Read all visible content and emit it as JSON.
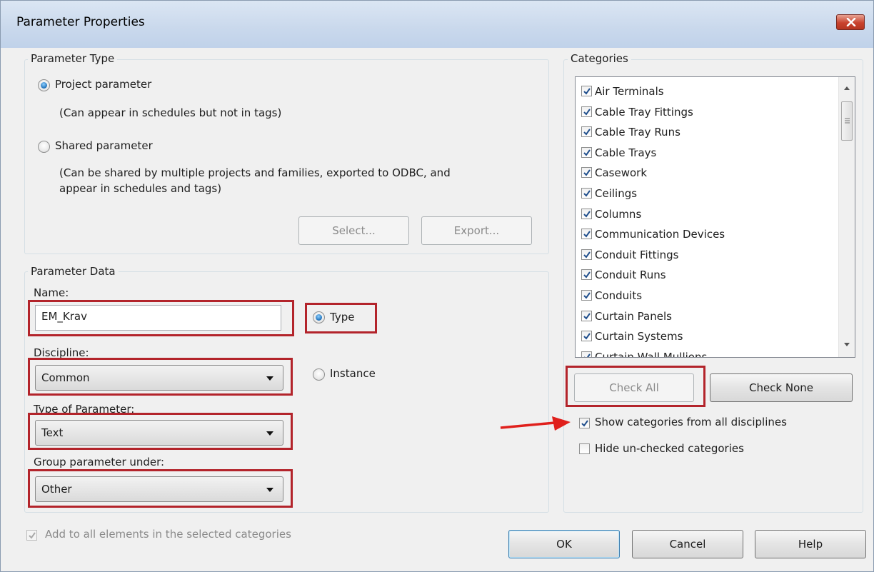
{
  "window": {
    "title": "Parameter Properties"
  },
  "parameter_type": {
    "legend": "Parameter Type",
    "project_label": "Project parameter",
    "project_desc": "(Can appear in schedules but not in tags)",
    "shared_label": "Shared parameter",
    "shared_desc_1": "(Can be shared by multiple projects and families, exported to ODBC, and",
    "shared_desc_2": "appear in schedules and tags)",
    "select_btn": "Select...",
    "export_btn": "Export..."
  },
  "parameter_data": {
    "legend": "Parameter Data",
    "name_label": "Name:",
    "name_value": "EM_Krav",
    "type_label": "Type",
    "instance_label": "Instance",
    "discipline_label": "Discipline:",
    "discipline_value": "Common",
    "type_of_param_label": "Type of Parameter:",
    "type_of_param_value": "Text",
    "group_label": "Group parameter under:",
    "group_value": "Other"
  },
  "add_all_label": "Add to all elements in the selected categories",
  "categories": {
    "legend": "Categories",
    "items": [
      "Air Terminals",
      "Cable Tray Fittings",
      "Cable Tray Runs",
      "Cable Trays",
      "Casework",
      "Ceilings",
      "Columns",
      "Communication Devices",
      "Conduit Fittings",
      "Conduit Runs",
      "Conduits",
      "Curtain Panels",
      "Curtain Systems",
      "Curtain Wall Mullions"
    ],
    "check_all": "Check All",
    "check_none": "Check None",
    "show_all_label": "Show categories from all disciplines",
    "hide_unchecked_label": "Hide un-checked categories"
  },
  "buttons": {
    "ok": "OK",
    "cancel": "Cancel",
    "help": "Help"
  },
  "colors": {
    "highlight": "#b3242b",
    "arrow": "#e0201c",
    "close_button": "#c9432e"
  }
}
